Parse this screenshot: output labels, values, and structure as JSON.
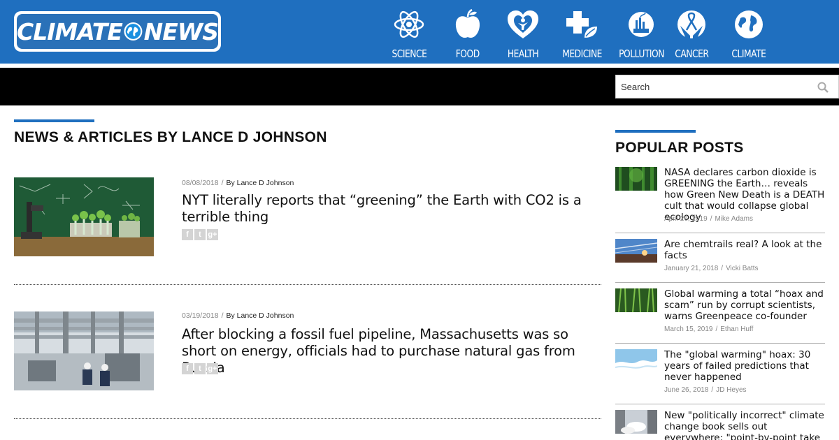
{
  "header": {
    "logo": {
      "left": "CLIMATE",
      "right": "NEWS"
    },
    "nav": [
      {
        "label": "SCIENCE",
        "icon": "atom-icon"
      },
      {
        "label": "FOOD",
        "icon": "apple-icon"
      },
      {
        "label": "HEALTH",
        "icon": "heart-person-icon"
      },
      {
        "label": "MEDICINE",
        "icon": "medical-cross-leaf-icon"
      },
      {
        "label": "POLLUTION",
        "icon": "factory-icon"
      },
      {
        "label": "CANCER",
        "icon": "ribbon-hands-icon"
      },
      {
        "label": "CLIMATE",
        "icon": "globe-icon"
      }
    ]
  },
  "search": {
    "placeholder": "Search"
  },
  "main": {
    "title": "NEWS & ARTICLES BY LANCE D JOHNSON",
    "articles": [
      {
        "date": "08/08/2018",
        "author": "By Lance D Johnson",
        "title": "NYT literally reports that “greening” the Earth with CO2 is a terrible thing",
        "shares": [
          "f",
          "t",
          "g+"
        ]
      },
      {
        "date": "03/19/2018",
        "author": "By Lance D Johnson",
        "title": "After blocking a fossil fuel pipeline, Massachusetts was so short on energy, officials had to purchase natural gas from Russia",
        "shares": [
          "f",
          "t",
          "g+"
        ]
      }
    ]
  },
  "sidebar": {
    "title": "POPULAR POSTS",
    "posts": [
      {
        "title": "NASA declares carbon dioxide is GREENING the Earth… reveals how Green New Death is a DEATH cult that would collapse global ecology",
        "date": "April 26, 2019",
        "author": "Mike Adams"
      },
      {
        "title": "Are chemtrails real? A look at the facts",
        "date": "January 21, 2018",
        "author": "Vicki Batts"
      },
      {
        "title": "Global warming a total “hoax and scam” run by corrupt scientists, warns Greenpeace co-founder",
        "date": "March 15, 2019",
        "author": "Ethan Huff"
      },
      {
        "title": "The \"global warming\" hoax: 30 years of failed predictions that never happened",
        "date": "June 26, 2018",
        "author": "JD Heyes"
      },
      {
        "title": "New \"politically incorrect\" climate change book sells out everywhere; \"point-by-point take down\" of",
        "date": "",
        "author": ""
      }
    ]
  },
  "colors": {
    "brand_blue": "#1f6fbf",
    "bar": "#000000",
    "divider": "#444444"
  }
}
